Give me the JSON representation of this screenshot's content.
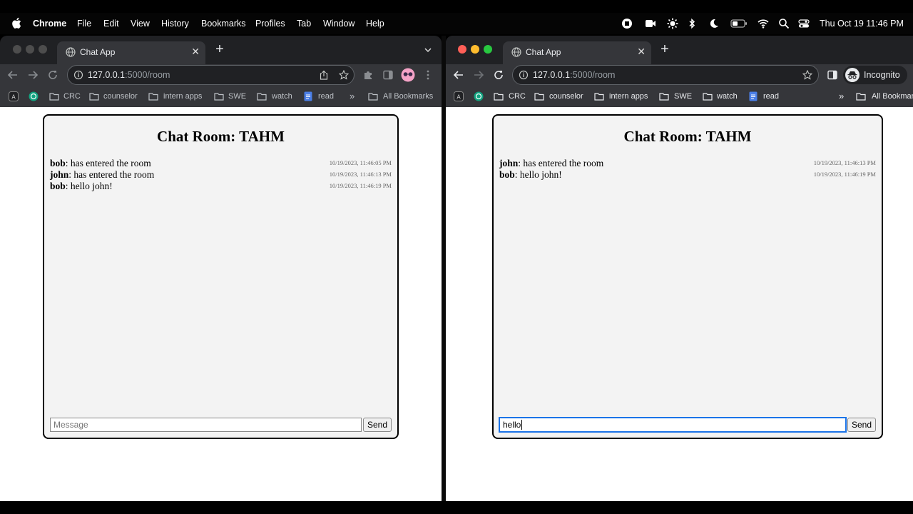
{
  "menubar": {
    "app_name": "Chrome",
    "items": [
      "File",
      "Edit",
      "View",
      "History",
      "Bookmarks",
      "Profiles",
      "Tab",
      "Window",
      "Help"
    ],
    "clock": "Thu Oct 19  11:46 PM"
  },
  "left_window": {
    "tab_title": "Chat App",
    "url_host": "127.0.0.1",
    "url_path": ":5000/room",
    "bookmarks": [
      "CRC",
      "counselor",
      "intern apps",
      "SWE",
      "watch",
      "read"
    ],
    "bookmarks_overflow": "»",
    "all_bookmarks": "All Bookmarks",
    "chat": {
      "title": "Chat Room: TAHM",
      "messages": [
        {
          "author": "bob",
          "text": ": has entered the room",
          "time": "10/19/2023, 11:46:05 PM"
        },
        {
          "author": "john",
          "text": ": has entered the room",
          "time": "10/19/2023, 11:46:13 PM"
        },
        {
          "author": "bob",
          "text": ": hello john!",
          "time": "10/19/2023, 11:46:19 PM"
        }
      ],
      "input_placeholder": "Message",
      "input_value": "",
      "send_label": "Send"
    }
  },
  "right_window": {
    "tab_title": "Chat App",
    "url_host": "127.0.0.1",
    "url_path": ":5000/room",
    "profile_label": "Incognito",
    "bookmarks": [
      "CRC",
      "counselor",
      "intern apps",
      "SWE",
      "watch",
      "read"
    ],
    "bookmarks_overflow": "»",
    "all_bookmarks": "All Bookmar",
    "chat": {
      "title": "Chat Room: TAHM",
      "messages": [
        {
          "author": "john",
          "text": ": has entered the room",
          "time": "10/19/2023, 11:46:13 PM"
        },
        {
          "author": "bob",
          "text": ": hello john!",
          "time": "10/19/2023, 11:46:19 PM"
        }
      ],
      "input_value": "hello",
      "send_label": "Send"
    }
  },
  "colors": {
    "chat_bg": "#f3f3f3",
    "focus_ring": "#1a73e8",
    "traffic_red": "#ff5f57",
    "traffic_yellow": "#febc2e",
    "traffic_green": "#28c840"
  }
}
